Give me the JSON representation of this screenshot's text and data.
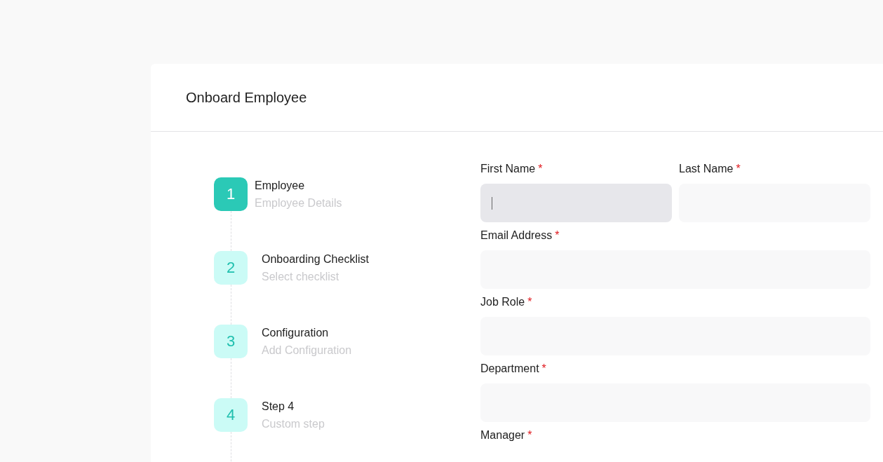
{
  "title": "Onboard Employee",
  "steps": [
    {
      "number": "1",
      "title": "Employee",
      "subtitle": "Employee Details",
      "selected": true
    },
    {
      "number": "2",
      "title": "Onboarding Checklist",
      "subtitle": "Select checklist",
      "selected": false
    },
    {
      "number": "3",
      "title": "Configuration",
      "subtitle": "Add Configuration",
      "selected": false
    },
    {
      "number": "4",
      "title": "Step 4",
      "subtitle": "Custom step",
      "selected": false
    }
  ],
  "form_rows": [
    [
      {
        "label": "First Name",
        "required_mark": "*",
        "kind": "input",
        "focused": true
      },
      {
        "label": "Last Name",
        "required_mark": "*",
        "kind": "input",
        "focused": false
      }
    ],
    [
      {
        "label": "Email Address",
        "required_mark": "*",
        "kind": "input",
        "focused": false
      }
    ],
    [
      {
        "label": "Job Role",
        "required_mark": "*",
        "kind": "input",
        "focused": false
      }
    ],
    [
      {
        "label": "Department",
        "required_mark": "*",
        "kind": "input",
        "focused": false
      }
    ],
    [
      {
        "label": "Manager",
        "required_mark": "*",
        "kind": "label_only"
      }
    ]
  ]
}
